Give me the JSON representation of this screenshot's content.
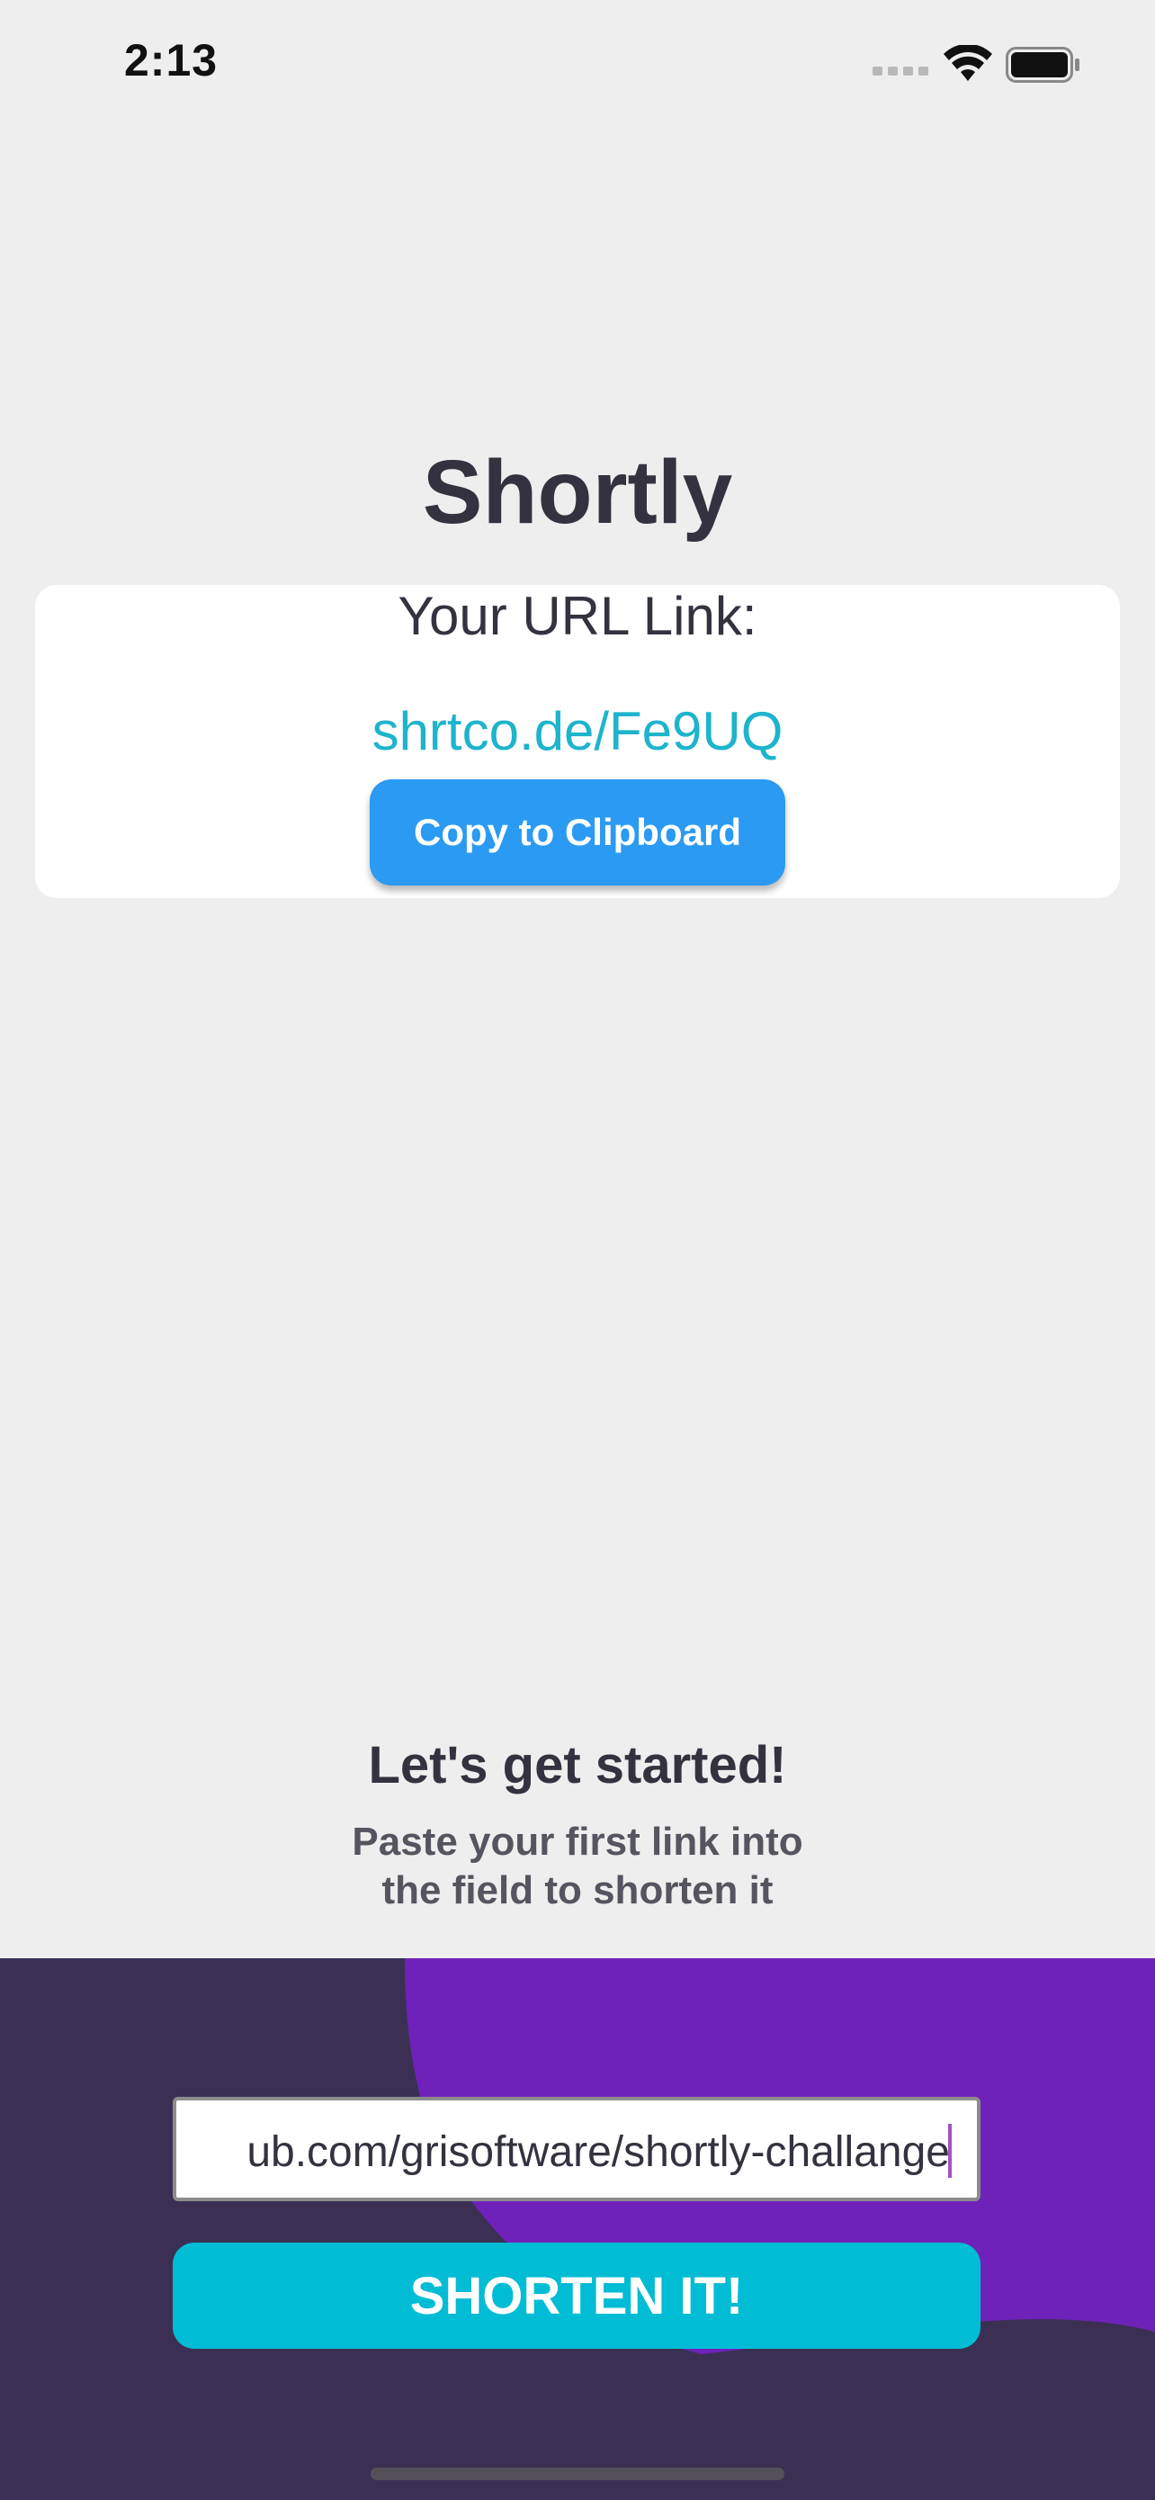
{
  "status_bar": {
    "time": "2:13"
  },
  "app": {
    "title": "Shortly"
  },
  "result": {
    "label": "Your URL Link:",
    "short_url": "shrtco.de/Fe9UQ",
    "copy_button_label": "Copy to Clipboard"
  },
  "intro": {
    "heading": "Let's get started!",
    "text": "Paste your first link into\nthe field to shorten it"
  },
  "form": {
    "input_value": "ub.com/grisoftware/shortly-challange",
    "submit_label": "SHORTEN IT!"
  },
  "colors": {
    "background": "#eeeeee",
    "title": "#35323f",
    "link": "#1db4cc",
    "copy_button": "#2b9af3",
    "panel": "#3b3054",
    "panel_shape": "#6f22b9",
    "shorten_button": "#00bcd4"
  },
  "icons": [
    "cellular-signal-icon",
    "wifi-icon",
    "battery-icon"
  ]
}
